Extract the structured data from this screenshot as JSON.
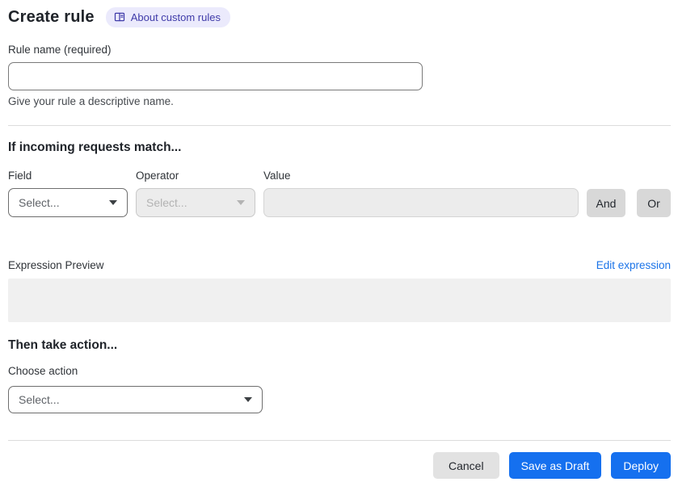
{
  "header": {
    "title": "Create rule",
    "about_badge": "About custom rules"
  },
  "rule_name": {
    "label": "Rule name (required)",
    "value": "",
    "help": "Give your rule a descriptive name."
  },
  "match": {
    "heading": "If incoming requests match...",
    "field_label": "Field",
    "field_placeholder": "Select...",
    "operator_label": "Operator",
    "operator_placeholder": "Select...",
    "value_label": "Value",
    "value_value": "",
    "and_button": "And",
    "or_button": "Or",
    "preview_label": "Expression Preview",
    "edit_link": "Edit expression",
    "preview_value": ""
  },
  "action": {
    "heading": "Then take action...",
    "label": "Choose action",
    "placeholder": "Select..."
  },
  "footer": {
    "cancel": "Cancel",
    "save_draft": "Save as Draft",
    "deploy": "Deploy"
  },
  "icons": {
    "badge_icon": "book-icon",
    "select_icon": "chevron-down-icon"
  },
  "colors": {
    "primary_blue": "#1570ef",
    "link_blue": "#1a73e8",
    "badge_bg": "#ebeafc",
    "badge_text": "#3f3ba9",
    "disabled_bg": "#ececec",
    "preview_bg": "#f0f0f0",
    "conjunction_bg": "#d8d8d8"
  }
}
